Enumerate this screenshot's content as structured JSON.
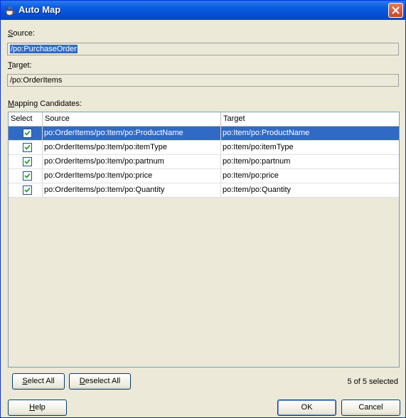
{
  "window": {
    "title": "Auto Map"
  },
  "source": {
    "label_prefix": "S",
    "label_rest": "ource:",
    "value": "/po:PurchaseOrder"
  },
  "target": {
    "label_prefix": "T",
    "label_rest": "arget:",
    "value": "/po:OrderItems"
  },
  "candidates": {
    "label_prefix": "M",
    "label_rest": "apping Candidates:",
    "columns": [
      "Select",
      "Source",
      "Target"
    ],
    "rows": [
      {
        "checked": true,
        "source": "po:OrderItems/po:Item/po:ProductName",
        "target": "po:Item/po:ProductName",
        "selected": true
      },
      {
        "checked": true,
        "source": "po:OrderItems/po:Item/po:itemType",
        "target": "po:Item/po:itemType",
        "selected": false
      },
      {
        "checked": true,
        "source": "po:OrderItems/po:Item/po:partnum",
        "target": "po:Item/po:partnum",
        "selected": false
      },
      {
        "checked": true,
        "source": "po:OrderItems/po:Item/po:price",
        "target": "po:Item/po:price",
        "selected": false
      },
      {
        "checked": true,
        "source": "po:OrderItems/po:Item/po:Quantity",
        "target": "po:Item/po:Quantity",
        "selected": false
      }
    ]
  },
  "buttons": {
    "select_all_prefix": "S",
    "select_all_rest": "elect All",
    "deselect_all_prefix": "D",
    "deselect_all_rest": "eselect All",
    "help_prefix": "H",
    "help_rest": "elp",
    "ok": "OK",
    "cancel": "Cancel"
  },
  "status": {
    "selected_text": "5 of 5 selected"
  },
  "colors": {
    "title_bar": "#0a5de0",
    "selection": "#316ac5",
    "dialog_bg": "#ece9d8"
  },
  "icons": {
    "title": "java-cup-icon",
    "close": "close-icon",
    "check": "checkmark-icon"
  }
}
